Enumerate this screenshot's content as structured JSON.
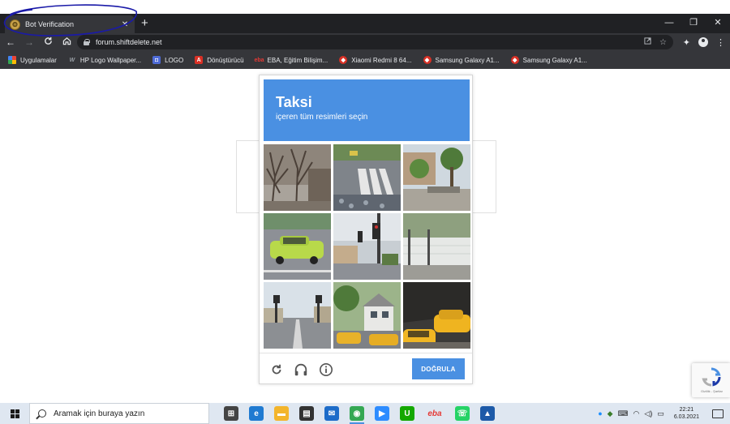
{
  "browser": {
    "tab": {
      "title": "Bot Verification",
      "close": "✕"
    },
    "new_tab": "+",
    "window_controls": {
      "minimize": "—",
      "restore": "❐",
      "close": "✕"
    },
    "nav": {
      "back": "←",
      "forward": "→",
      "reload": "C",
      "home": "⌂"
    },
    "address": {
      "url": "forum.shiftdelete.net"
    },
    "bookmarks": [
      {
        "label": "Uygulamalar",
        "icon": "apps-icon"
      },
      {
        "label": "HP Logo Wallpaper...",
        "icon": "hp-icon"
      },
      {
        "label": "LOGO",
        "icon": "logo-icon"
      },
      {
        "label": "Dönüştürücü",
        "icon": "pdf-icon"
      },
      {
        "label": "EBA, Eğitim Bilişim...",
        "icon": "eba-icon"
      },
      {
        "label": "Xiaomi Redmi 8 64...",
        "icon": "site-icon"
      },
      {
        "label": "Samsung Galaxy A1...",
        "icon": "site-icon"
      },
      {
        "label": "Samsung Galaxy A1...",
        "icon": "site-icon"
      }
    ]
  },
  "captcha": {
    "target_word": "Taksi",
    "instruction": "içeren tüm resimleri seçin",
    "verify_label": "DOĞRULA",
    "colors": {
      "header": "#4a90e2",
      "button": "#4a90e2"
    },
    "tiles": [
      {
        "scene": "bare-trees"
      },
      {
        "scene": "crosswalk"
      },
      {
        "scene": "palm-street"
      },
      {
        "scene": "taxi-car"
      },
      {
        "scene": "traffic-light"
      },
      {
        "scene": "white-wall"
      },
      {
        "scene": "road-signals"
      },
      {
        "scene": "house-taxis"
      },
      {
        "scene": "taxi-closeup"
      }
    ]
  },
  "recaptcha_badge": {
    "text": "Gizlilik - Şartlar"
  },
  "taskbar": {
    "search_placeholder": "Aramak için buraya yazın",
    "clock": {
      "time": "22:21",
      "date": "6.03.2021"
    },
    "apps": [
      {
        "name": "task-view-icon",
        "label": "⊞",
        "color": "#444444"
      },
      {
        "name": "edge-icon",
        "label": "e",
        "color": "#1f7ad1"
      },
      {
        "name": "explorer-icon",
        "label": "▬",
        "color": "#f3b52c"
      },
      {
        "name": "store-icon",
        "label": "▤",
        "color": "#333333"
      },
      {
        "name": "mail-icon",
        "label": "✉",
        "color": "#1d6cc9"
      },
      {
        "name": "chrome-icon",
        "label": "◉",
        "color": "#34a853"
      },
      {
        "name": "zoom-icon",
        "label": "▶",
        "color": "#2d8cff"
      },
      {
        "name": "upwork-icon",
        "label": "U",
        "color": "#14a800"
      },
      {
        "name": "eba-taskbar-icon",
        "label": "eba",
        "color": "#ffffff"
      },
      {
        "name": "whatsapp-icon",
        "label": "☏",
        "color": "#25d366"
      },
      {
        "name": "photos-icon",
        "label": "▲",
        "color": "#1d5aa8"
      }
    ]
  }
}
